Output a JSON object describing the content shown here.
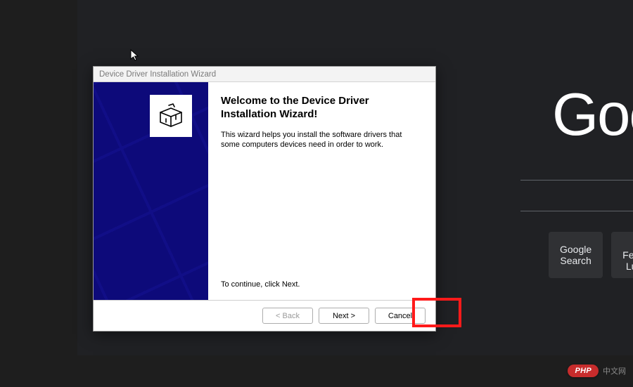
{
  "browser": {
    "logo": "Google",
    "buttons": {
      "search": "Google Search",
      "lucky": "I'm Feeling Lucky"
    }
  },
  "dialog": {
    "title": "Device Driver Installation Wizard",
    "heading": "Welcome to the Device Driver Installation Wizard!",
    "description": "This wizard helps you install the software drivers that some computers devices need in order to work.",
    "continue": "To continue, click Next.",
    "buttons": {
      "back": "< Back",
      "next": "Next >",
      "cancel": "Cancel"
    }
  },
  "badge": {
    "pill": "PHP",
    "text": "中文网"
  }
}
